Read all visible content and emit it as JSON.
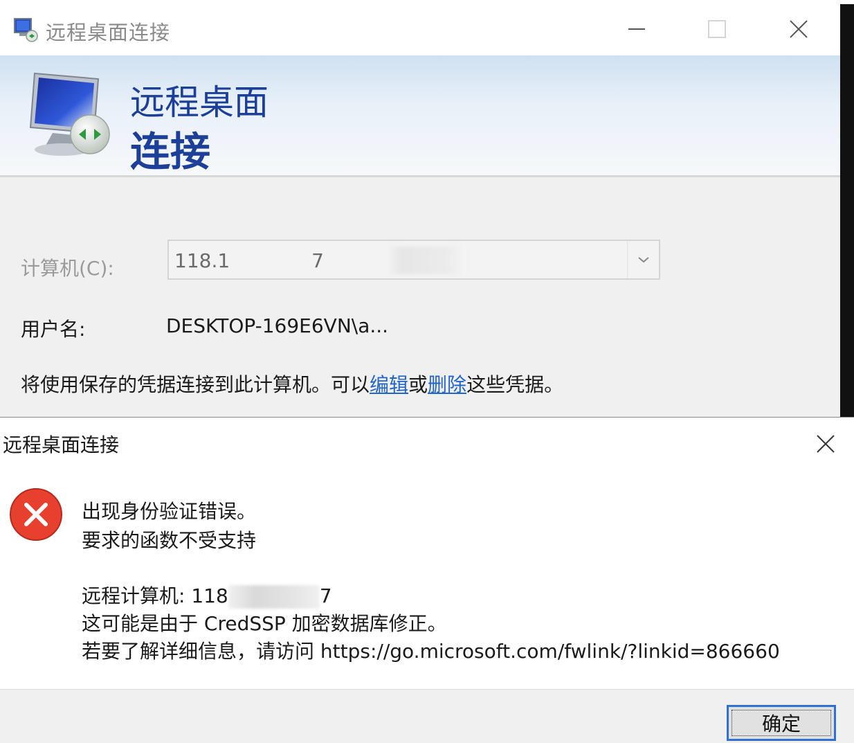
{
  "rdc_window": {
    "title": "远程桌面连接",
    "banner_line1": "远程桌面",
    "banner_line2": "连接",
    "computer_label": "计算机(C):",
    "computer_value": "118.1",
    "computer_value_tail": "7",
    "username_label": "用户名:",
    "username_value": "DESKTOP-169E6VN\\a...",
    "cred_note_prefix": "将使用保存的凭据连接到此计算机。可以",
    "cred_link_edit": "编辑",
    "cred_note_or": "或",
    "cred_link_delete": "删除",
    "cred_note_suffix": "这些凭据。"
  },
  "error_dialog": {
    "title": "远程桌面连接",
    "line1": "出现身份验证错误。",
    "line2": "要求的函数不受支持",
    "line3_prefix": "远程计算机: 118",
    "line3_suffix": "7",
    "line4": "这可能是由于 CredSSP 加密数据库修正。",
    "line5": "若要了解详细信息，请访问 https://go.microsoft.com/fwlink/?linkid=866660",
    "ok_label": "确定"
  },
  "icons": {
    "app": "remote-desktop-icon",
    "error": "error-icon",
    "close": "close-icon",
    "minimize": "minimize-icon",
    "maximize": "maximize-icon",
    "dropdown": "chevron-down-icon"
  },
  "colors": {
    "banner_text": "#1c3f9a",
    "link": "#2266cc",
    "error_red": "#e8402f",
    "ok_border": "#2f6fd6"
  }
}
